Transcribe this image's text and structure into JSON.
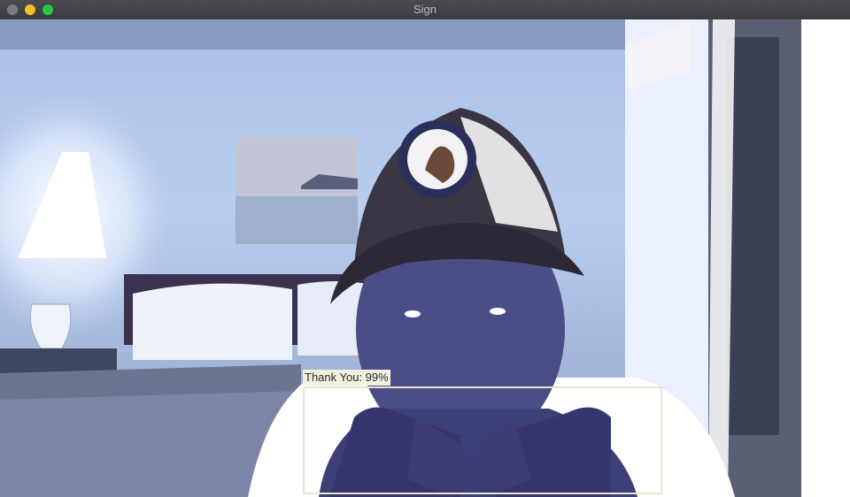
{
  "window": {
    "title": "Sign"
  },
  "detection": {
    "label": "Thank You: 99%"
  },
  "colors": {
    "box": "#e9e6cf",
    "label_bg": "#f2f0de"
  },
  "icons": [
    "close-traffic-light",
    "minimize-traffic-light",
    "maximize-traffic-light"
  ]
}
